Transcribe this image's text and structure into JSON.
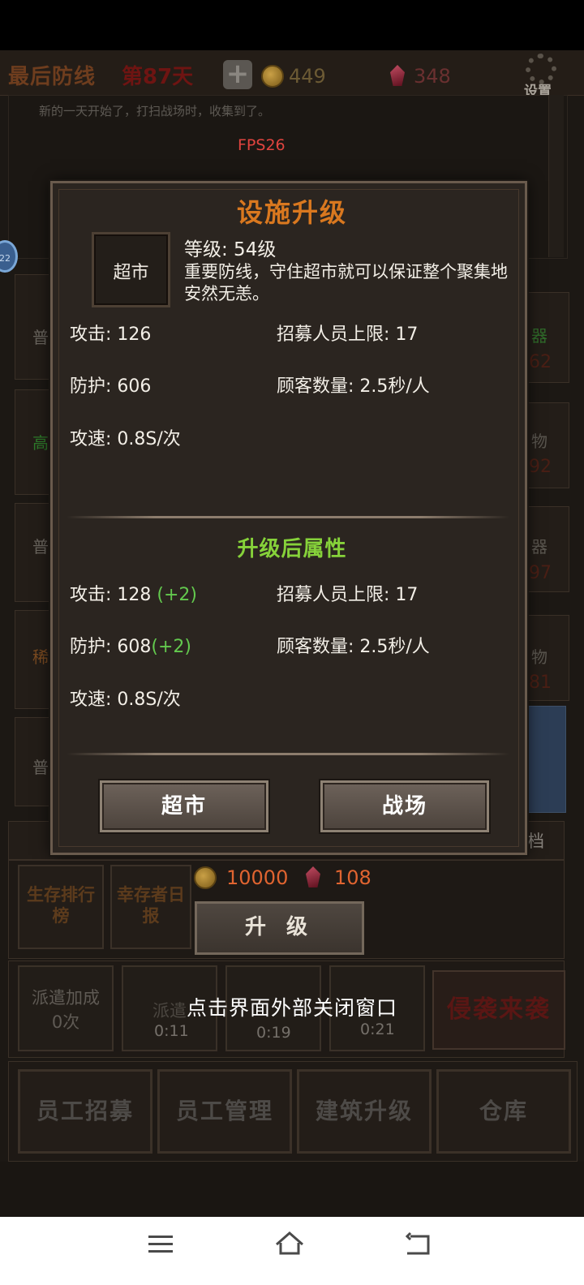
{
  "header": {
    "game_title": "最后防线",
    "day": "第87天",
    "gold": "449",
    "gems": "348",
    "settings_label": "设置"
  },
  "log": {
    "message": "新的一天开始了，打扫战场时，收集到了。",
    "fps": "FPS26"
  },
  "badge": "22",
  "background_rows": {
    "left_tags": [
      "普",
      "高",
      "普",
      "稀",
      "普"
    ],
    "right_tags": [
      "器",
      "物",
      "器",
      "物"
    ],
    "right_nums": [
      "62",
      "92",
      "97",
      "81"
    ],
    "archive_label": "档"
  },
  "modal": {
    "title": "设施升级",
    "facility_name": "超市",
    "level": "等级: 54级",
    "description": "重要防线，守住超市就可以保证整个聚集地安然无恙。",
    "current": {
      "attack_label": "攻击: ",
      "attack_value": "126",
      "defense_label": "防护: ",
      "defense_value": "606",
      "speed_label": "攻速: ",
      "speed_value": "0.8S/次",
      "recruit_label": "招募人员上限: ",
      "recruit_value": "17",
      "customers_label": "顾客数量: ",
      "customers_value": "2.5秒/人"
    },
    "after_title": "升级后属性",
    "after": {
      "attack_label": "攻击: ",
      "attack_value": "128",
      "attack_delta": "(+2)",
      "defense_label": "防护: ",
      "defense_value": "608",
      "defense_delta": "(+2)",
      "speed_label": "攻速: ",
      "speed_value": "0.8S/次",
      "recruit_label": "招募人员上限: ",
      "recruit_value": "17",
      "customers_label": "顾客数量: ",
      "customers_value": "2.5秒/人"
    },
    "button_supermarket": "超市",
    "button_battlefield": "战场"
  },
  "upgrade": {
    "coin_cost": "10000",
    "gem_cost": "108",
    "button": "升 级"
  },
  "side": {
    "ranking": "生存排行榜",
    "survivor_daily": "幸存者日报"
  },
  "dispatch": {
    "bonus_label": "派遣加成",
    "bonus_count": "0次",
    "slot_label": "派遣",
    "timers": [
      "0:11",
      "0:19",
      "0:21"
    ],
    "invade": "侵袭来袭"
  },
  "close_hint": "点击界面外部关闭窗口",
  "bottom_menu": [
    "员工招募",
    "员工管理",
    "建筑升级",
    "仓库"
  ],
  "colors": {
    "title_orange": "#d9781f",
    "upgrade_green": "#86d23a",
    "delta_green": "#63c94e",
    "cost_orange": "#e06430",
    "fps_red": "#e0443f"
  }
}
